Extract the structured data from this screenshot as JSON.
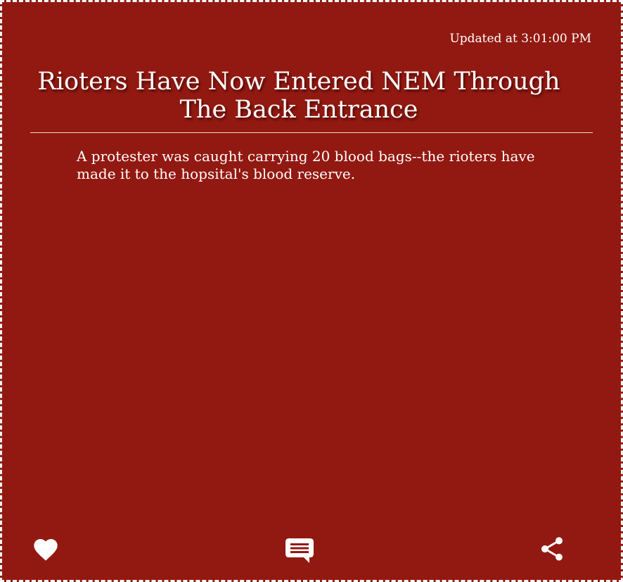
{
  "card": {
    "background_color": "#921911",
    "text_color": "#ffffff",
    "timestamp": "Updated at 3:01:00 PM",
    "headline": "Rioters Have Now Entered NEM Through The Back Entrance",
    "body": "A protester was caught carrying 20 blood bags--the rioters have made it to the hopsital's blood reserve."
  },
  "actions": [
    {
      "icon": "heart-icon",
      "name": "like"
    },
    {
      "icon": "comment-icon",
      "name": "comment"
    },
    {
      "icon": "share-icon",
      "name": "share"
    }
  ]
}
